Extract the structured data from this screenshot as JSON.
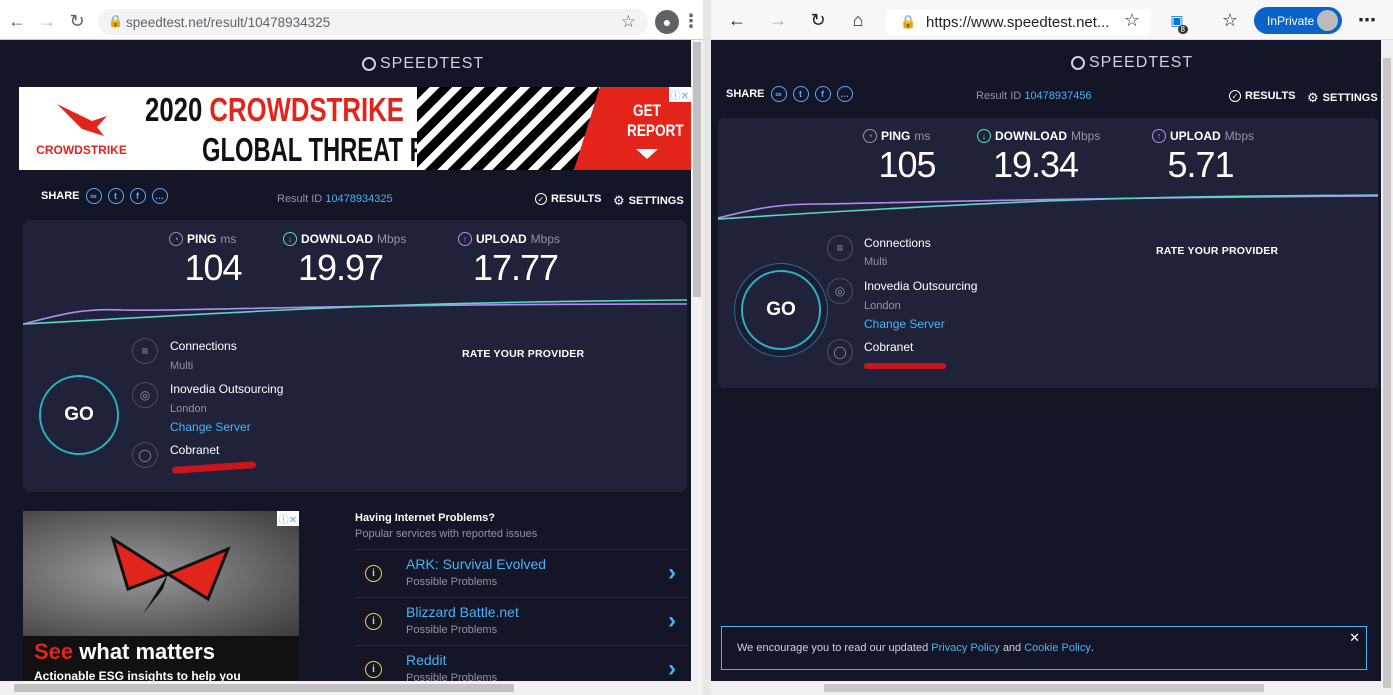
{
  "left": {
    "url": "speedtest.net/result/10478934325",
    "brand": "SPEEDTEST",
    "ad_top": {
      "title1a": "2020 ",
      "title1b": "CROWDSTRIKE",
      "title2": "GLOBAL THREAT REPORT",
      "brand": "CROWDSTRIKE",
      "cta": "GET REPORT"
    },
    "share_label": "SHARE",
    "result_label": "Result ID",
    "result_id": "10478934325",
    "results_label": "RESULTS",
    "settings_label": "SETTINGS",
    "ping": {
      "label": "PING",
      "unit": "ms",
      "value": "104"
    },
    "download": {
      "label": "DOWNLOAD",
      "unit": "Mbps",
      "value": "19.97"
    },
    "upload": {
      "label": "UPLOAD",
      "unit": "Mbps",
      "value": "17.77"
    },
    "go": "GO",
    "connections_label": "Connections",
    "connections_value": "Multi",
    "server_name": "Inovedia Outsourcing",
    "server_location": "London",
    "change_server": "Change Server",
    "isp_name": "Cobranet",
    "rate_provider": "RATE YOUR PROVIDER",
    "problems_title": "Having Internet Problems?",
    "problems_sub": "Popular services with reported issues",
    "problems": [
      {
        "name": "ARK: Survival Evolved",
        "status": "Possible Problems"
      },
      {
        "name": "Blizzard Battle.net",
        "status": "Possible Problems"
      },
      {
        "name": "Reddit",
        "status": "Possible Problems"
      }
    ],
    "ad_bottom": {
      "see": "See",
      "matters": " what matters",
      "line2": "Actionable ESG insights to help you"
    }
  },
  "right": {
    "url": "https://www.speedtest.net...",
    "inprivate": "InPrivate",
    "ext_badge": "8",
    "brand": "SPEEDTEST",
    "share_label": "SHARE",
    "result_label": "Result ID",
    "result_id": "10478937456",
    "results_label": "RESULTS",
    "settings_label": "SETTINGS",
    "ping": {
      "label": "PING",
      "unit": "ms",
      "value": "105"
    },
    "download": {
      "label": "DOWNLOAD",
      "unit": "Mbps",
      "value": "19.34"
    },
    "upload": {
      "label": "UPLOAD",
      "unit": "Mbps",
      "value": "5.71"
    },
    "go": "GO",
    "connections_label": "Connections",
    "connections_value": "Multi",
    "server_name": "Inovedia Outsourcing",
    "server_location": "London",
    "change_server": "Change Server",
    "isp_name": "Cobranet",
    "rate_provider": "RATE YOUR PROVIDER",
    "cookie": {
      "pre": "We encourage you to read our updated ",
      "privacy": "Privacy Policy",
      "mid": " and ",
      "cookie": "Cookie Policy",
      "post": "."
    }
  },
  "colors": {
    "bg": "#141526",
    "panel": "#20223a",
    "accent": "#45b4f5",
    "download": "#56d7c8",
    "upload": "#b38bf5"
  }
}
